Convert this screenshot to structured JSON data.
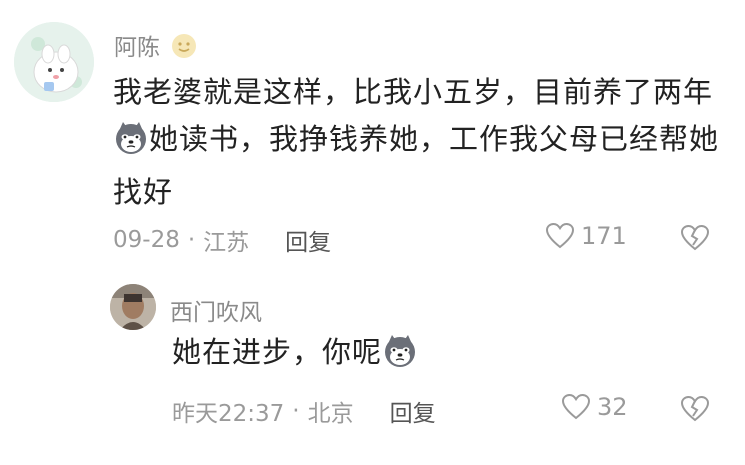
{
  "comment": {
    "author": "阿陈",
    "text_before_icon": "我老婆就是这样，比我小五岁，目前养了两年",
    "text_after_icon": "她读书，我挣钱养她，工作我父母已经帮她找好",
    "date": "09-28",
    "location": "江苏",
    "reply_label": "回复",
    "like_count": "171",
    "icons": {
      "avatar": "cartoon-avatar",
      "name_badge": "emoji-smile-icon",
      "inline": "husky-emoji-icon",
      "like": "heart-icon",
      "dislike": "broken-heart-icon"
    }
  },
  "reply": {
    "author": "西门吹风",
    "text": "她在进步，你呢",
    "date": "昨天22:37",
    "location": "北京",
    "reply_label": "回复",
    "like_count": "32",
    "icons": {
      "avatar": "photo-avatar",
      "inline": "husky-emoji-icon",
      "like": "heart-icon",
      "dislike": "broken-heart-icon"
    }
  },
  "separator": "·"
}
